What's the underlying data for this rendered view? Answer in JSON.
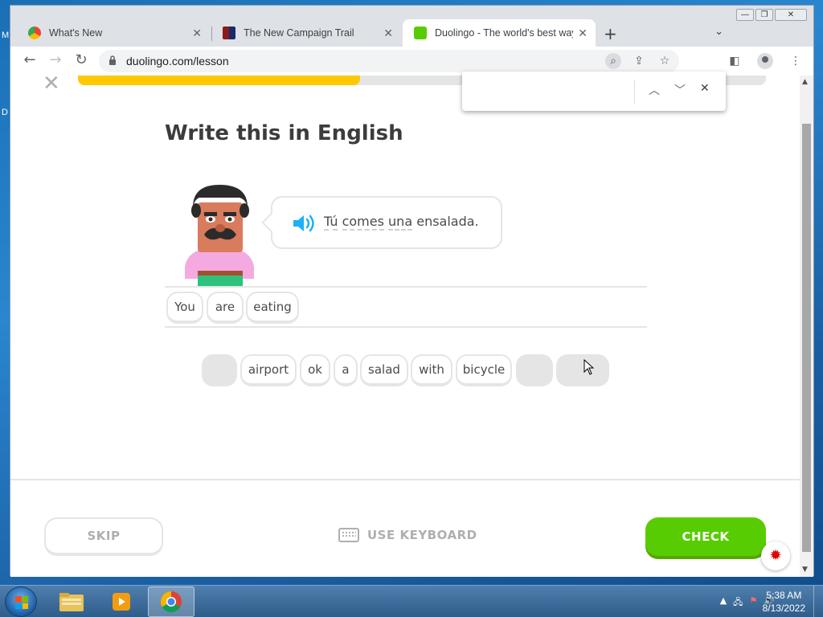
{
  "browser": {
    "tabs": [
      {
        "title": "What's New",
        "icon": "chrome-icon"
      },
      {
        "title": "The New Campaign Trail",
        "icon": "campaign-trail-icon"
      },
      {
        "title": "Duolingo - The world's best way",
        "icon": "duolingo-owl-icon"
      }
    ],
    "url": "duolingo.com/lesson"
  },
  "lesson": {
    "progress": 0.41,
    "prompt": "Write this in English",
    "sentence_words": [
      "Tú",
      "comes",
      "una",
      "ensalada."
    ],
    "selected_words": [
      "You",
      "are",
      "eating"
    ],
    "word_bank": [
      {
        "label": "",
        "used": true
      },
      {
        "label": "airport",
        "used": false
      },
      {
        "label": "ok",
        "used": false
      },
      {
        "label": "a",
        "used": false
      },
      {
        "label": "salad",
        "used": false
      },
      {
        "label": "with",
        "used": false
      },
      {
        "label": "bicycle",
        "used": false
      },
      {
        "label": "",
        "used": true
      },
      {
        "label": "",
        "used": true
      }
    ],
    "skip_label": "SKIP",
    "keyboard_label": "USE KEYBOARD",
    "check_label": "CHECK"
  },
  "taskbar": {
    "time": "5:38 AM",
    "date": "8/13/2022"
  },
  "colors": {
    "check_green": "#58cc02",
    "progress_yellow": "#ffc800",
    "speaker_blue": "#1cb0f6"
  }
}
